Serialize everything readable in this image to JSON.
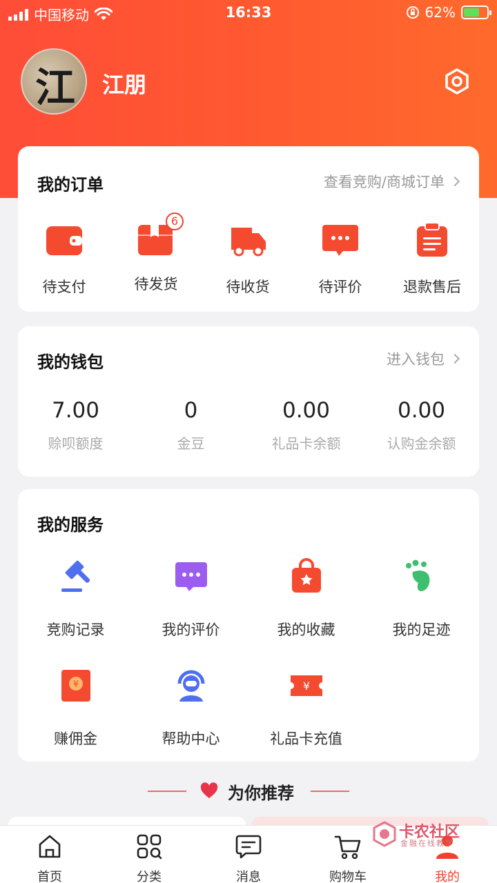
{
  "status_bar": {
    "carrier": "中国移动",
    "time": "16:33",
    "battery": "62%"
  },
  "profile": {
    "avatar_char": "江",
    "name": "江朋"
  },
  "orders": {
    "title": "我的订单",
    "link": "查看竞购/商城订单",
    "items": [
      {
        "label": "待支付",
        "icon": "wallet-icon"
      },
      {
        "label": "待发货",
        "icon": "package-icon",
        "badge": "6"
      },
      {
        "label": "待收货",
        "icon": "truck-icon"
      },
      {
        "label": "待评价",
        "icon": "comment-icon"
      },
      {
        "label": "退款售后",
        "icon": "clipboard-icon"
      }
    ]
  },
  "wallet": {
    "title": "我的钱包",
    "link": "进入钱包",
    "items": [
      {
        "value": "7.00",
        "label": "赊呗额度"
      },
      {
        "value": "0",
        "label": "金豆"
      },
      {
        "value": "0.00",
        "label": "礼品卡余额"
      },
      {
        "value": "0.00",
        "label": "认购金余额"
      }
    ]
  },
  "services": {
    "title": "我的服务",
    "items": [
      {
        "label": "竞购记录",
        "icon": "gavel-icon"
      },
      {
        "label": "我的评价",
        "icon": "chat-bubble-icon"
      },
      {
        "label": "我的收藏",
        "icon": "favorite-bag-icon"
      },
      {
        "label": "我的足迹",
        "icon": "footprint-icon"
      },
      {
        "label": "赚佣金",
        "icon": "red-envelope-icon"
      },
      {
        "label": "帮助中心",
        "icon": "customer-service-icon"
      },
      {
        "label": "礼品卡充值",
        "icon": "gift-card-icon"
      }
    ]
  },
  "recommend": {
    "title": "为你推荐"
  },
  "tabbar": {
    "items": [
      {
        "label": "首页",
        "icon": "home-icon"
      },
      {
        "label": "分类",
        "icon": "category-icon"
      },
      {
        "label": "消息",
        "icon": "message-icon"
      },
      {
        "label": "购物车",
        "icon": "cart-icon"
      },
      {
        "label": "我的",
        "icon": "profile-icon",
        "active": true
      }
    ]
  },
  "watermark": {
    "title": "卡农社区",
    "subtitle": "金融在线教学"
  },
  "colors": {
    "accent": "#f0412e",
    "hero": "#ff5a30",
    "service_blue": "#4f6ef0",
    "service_purple": "#9b5cf0",
    "service_green": "#3fbf6e"
  }
}
